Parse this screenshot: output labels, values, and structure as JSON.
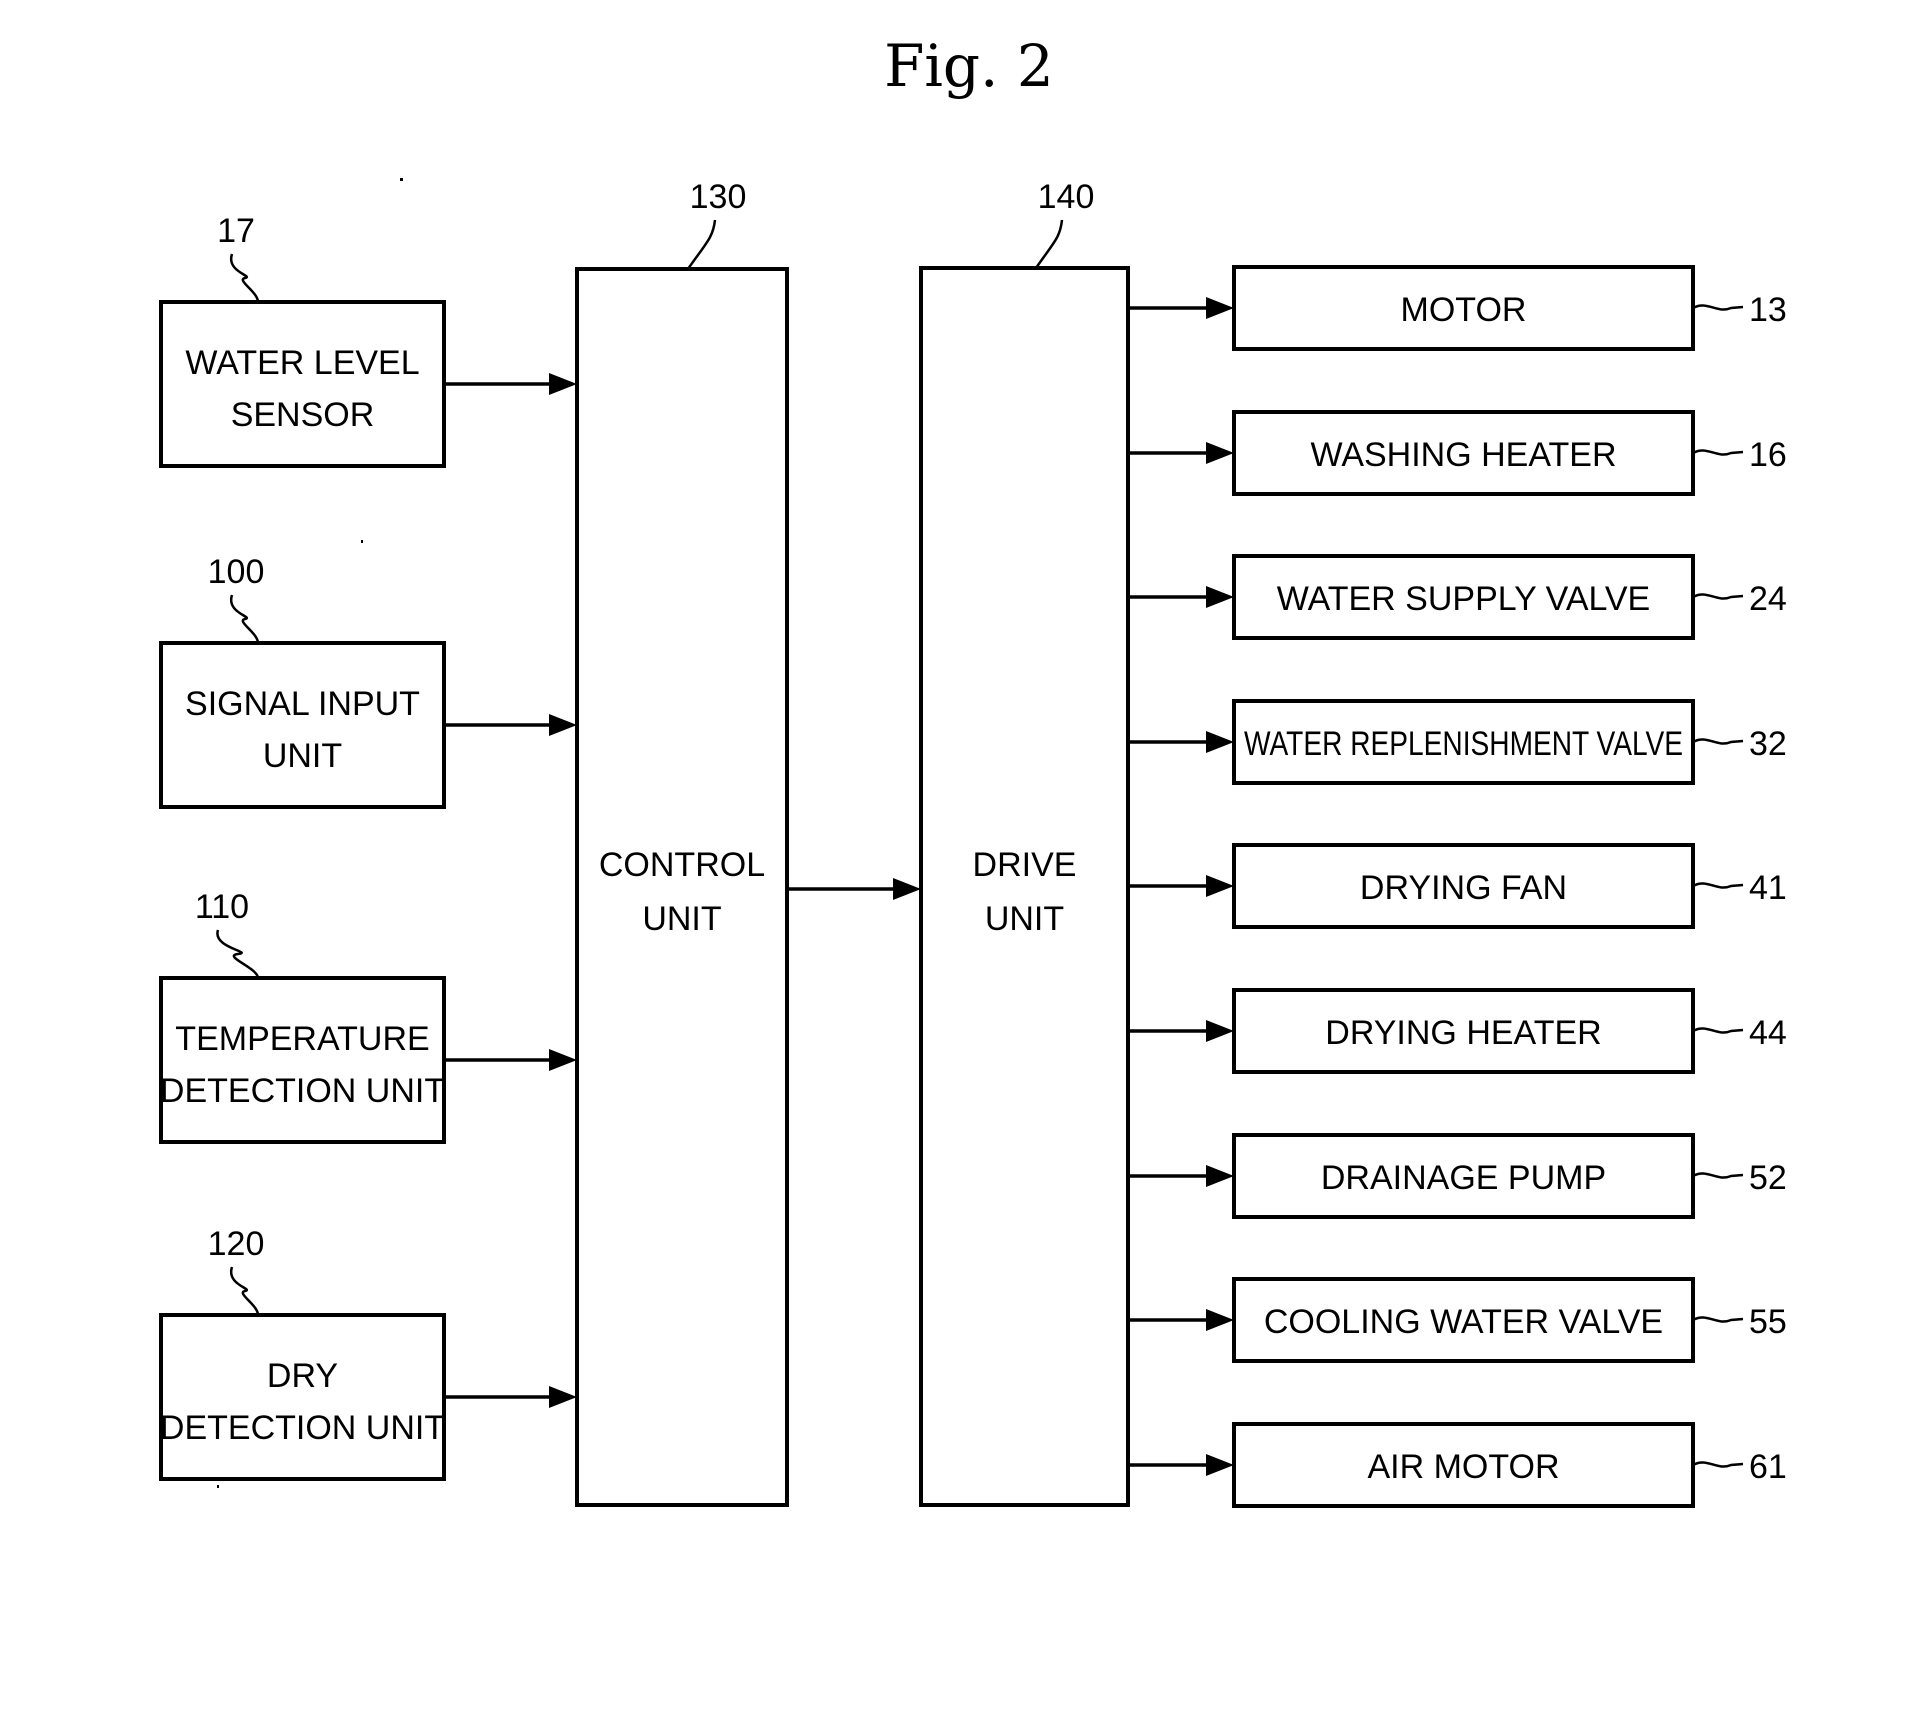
{
  "figure": {
    "title": "Fig. 2"
  },
  "inputs": [
    {
      "id": "water-level-sensor",
      "ref": "17",
      "lines": [
        "WATER LEVEL",
        "SENSOR"
      ]
    },
    {
      "id": "signal-input-unit",
      "ref": "100",
      "lines": [
        "SIGNAL INPUT",
        "UNIT"
      ]
    },
    {
      "id": "temperature-detection-unit",
      "ref": "110",
      "lines": [
        "TEMPERATURE",
        "DETECTION UNIT"
      ]
    },
    {
      "id": "dry-detection-unit",
      "ref": "120",
      "lines": [
        "DRY",
        "DETECTION UNIT"
      ]
    }
  ],
  "control": {
    "ref": "130",
    "lines": [
      "CONTROL",
      "UNIT"
    ]
  },
  "drive": {
    "ref": "140",
    "lines": [
      "DRIVE",
      "UNIT"
    ]
  },
  "outputs": [
    {
      "id": "motor",
      "ref": "13",
      "label": "MOTOR"
    },
    {
      "id": "washing-heater",
      "ref": "16",
      "label": "WASHING HEATER"
    },
    {
      "id": "water-supply-valve",
      "ref": "24",
      "label": "WATER SUPPLY VALVE"
    },
    {
      "id": "water-replenishment-valve",
      "ref": "32",
      "label": "WATER REPLENISHMENT VALVE"
    },
    {
      "id": "drying-fan",
      "ref": "41",
      "label": "DRYING FAN"
    },
    {
      "id": "drying-heater",
      "ref": "44",
      "label": "DRYING HEATER"
    },
    {
      "id": "drainage-pump",
      "ref": "52",
      "label": "DRAINAGE PUMP"
    },
    {
      "id": "cooling-water-valve",
      "ref": "55",
      "label": "COOLING WATER VALVE"
    },
    {
      "id": "air-motor",
      "ref": "61",
      "label": "AIR MOTOR"
    }
  ],
  "connections": [
    {
      "from": "water-level-sensor",
      "to": "control-unit"
    },
    {
      "from": "signal-input-unit",
      "to": "control-unit"
    },
    {
      "from": "temperature-detection-unit",
      "to": "control-unit"
    },
    {
      "from": "dry-detection-unit",
      "to": "control-unit"
    },
    {
      "from": "control-unit",
      "to": "drive-unit"
    },
    {
      "from": "drive-unit",
      "to": "motor"
    },
    {
      "from": "drive-unit",
      "to": "washing-heater"
    },
    {
      "from": "drive-unit",
      "to": "water-supply-valve"
    },
    {
      "from": "drive-unit",
      "to": "water-replenishment-valve"
    },
    {
      "from": "drive-unit",
      "to": "drying-fan"
    },
    {
      "from": "drive-unit",
      "to": "drying-heater"
    },
    {
      "from": "drive-unit",
      "to": "drainage-pump"
    },
    {
      "from": "drive-unit",
      "to": "cooling-water-valve"
    },
    {
      "from": "drive-unit",
      "to": "air-motor"
    }
  ]
}
